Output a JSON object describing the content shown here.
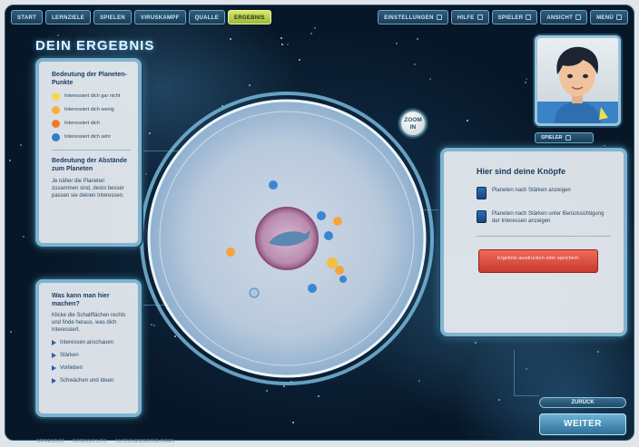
{
  "nav": {
    "left": [
      {
        "label": "START",
        "active": false
      },
      {
        "label": "LERNZIELE",
        "active": false
      },
      {
        "label": "SPIELEN",
        "active": false
      },
      {
        "label": "VIRUSKAMPF",
        "active": false
      },
      {
        "label": "QUALLE",
        "active": false
      },
      {
        "label": "ERGEBNIS",
        "active": true
      }
    ],
    "right": [
      {
        "label": "EINSTELLUNGEN",
        "dropdown": true
      },
      {
        "label": "HILFE",
        "dropdown": true
      },
      {
        "label": "SPIELER",
        "dropdown": true
      },
      {
        "label": "ANSICHT",
        "dropdown": true
      },
      {
        "label": "MENÜ",
        "dropdown": true
      }
    ]
  },
  "title": "DEIN ERGEBNIS",
  "legend": {
    "title": "Bedeutung der Planeten-Punkte",
    "items": [
      {
        "label": "Interessiert dich gar nicht",
        "color": "#f3d84a"
      },
      {
        "label": "Interessiert dich wenig",
        "color": "#f4b13c"
      },
      {
        "label": "Interessiert dich",
        "color": "#ef7a2e"
      },
      {
        "label": "Interessiert dich sehr",
        "color": "#2f7ec9"
      }
    ],
    "section2_title": "Bedeutung der Abstände zum Planeten",
    "section2_text": "Je näher die Planeten zusammen sind, desto besser passen sie deinen Interessen."
  },
  "help": {
    "title": "Was kann man hier machen?",
    "text": "Klicke die Schaltflächen rechts und finde heraus, was dich interessiert.",
    "items": [
      {
        "label": "Interessen anschauen"
      },
      {
        "label": "Stärken"
      },
      {
        "label": "Vorlieben"
      },
      {
        "label": "Schwächen und Ideen"
      }
    ]
  },
  "buttons_panel": {
    "title": "Hier sind deine Knöpfe",
    "items": [
      {
        "label": "Planeten nach Stärken anzeigen"
      },
      {
        "label": "Planeten nach Stärken unter Berücksichtigung der Interessen anzeigen"
      }
    ],
    "red_button_label": "Ergebnis ausdrucken oder speichern"
  },
  "avatar_button": "SPIELER",
  "zoom_label": "ZOOM IN",
  "back_button": "ZURÜCK",
  "next_button": "WEITER",
  "footer": [
    "IMPRESSUM",
    "DATENSCHUTZ",
    "NUTZUNGSBEDINGUNGEN"
  ],
  "colors": {
    "accent": "#7fb3cf",
    "active_nav": "#c7dc52",
    "red_button": "#e05247",
    "space": "#071727"
  }
}
